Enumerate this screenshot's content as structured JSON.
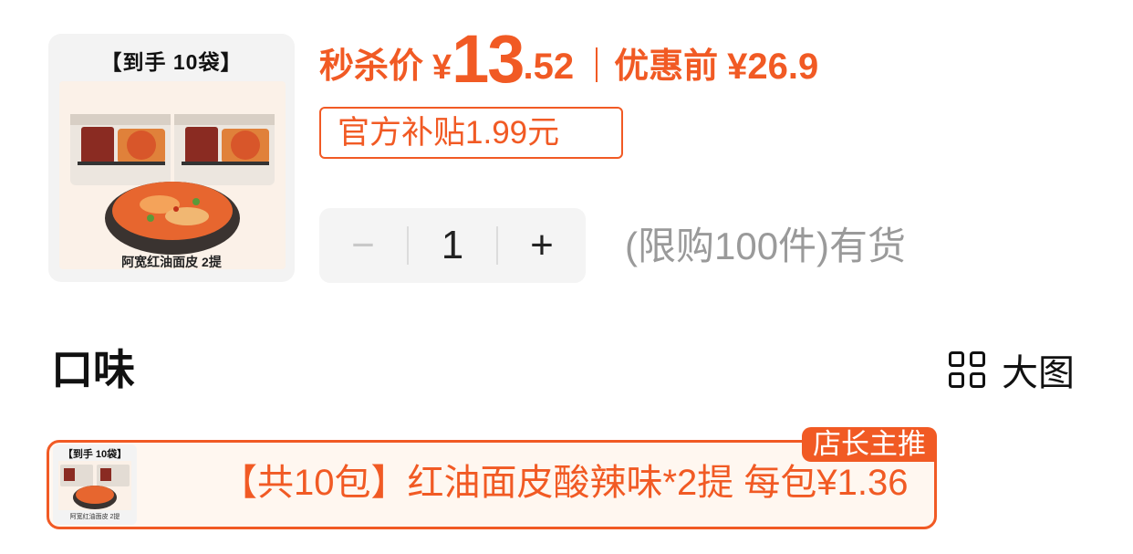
{
  "product": {
    "thumb_header": "【到手 10袋】",
    "thumb_caption": "阿宽红油面皮 2提"
  },
  "price": {
    "seckill_label": "秒杀价",
    "currency": "¥",
    "integer": "13",
    "decimal": ".52",
    "before_label": "优惠前",
    "before_price": "¥26.9"
  },
  "subsidy": "官方补贴1.99元",
  "quantity": {
    "minus": "−",
    "value": "1",
    "plus": "+",
    "stock_text": "(限购100件)有货"
  },
  "flavor_section": {
    "title": "口味",
    "big_image_label": "大图"
  },
  "option": {
    "thumb_header": "【到手 10袋】",
    "thumb_caption": "阿宽红油面皮 2提",
    "text": "【共10包】红油面皮酸辣味*2提  每包¥1.36",
    "badge": "店长主推"
  },
  "colors": {
    "accent": "#f15a24",
    "muted": "#9a9a9a"
  }
}
